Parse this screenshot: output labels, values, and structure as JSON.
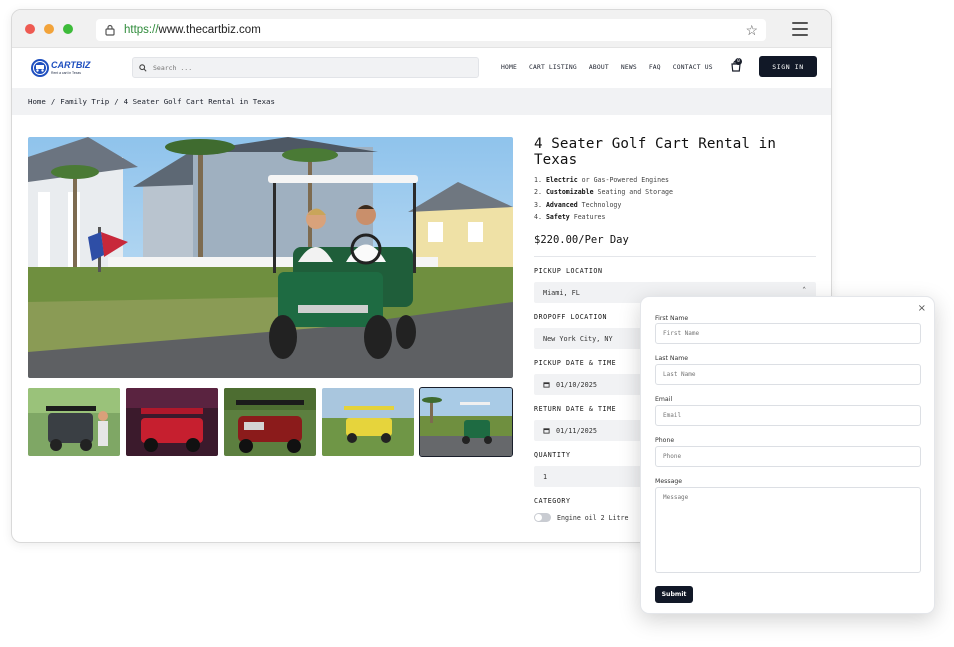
{
  "browser": {
    "url_scheme": "https://",
    "url_host": "www.thecartbiz.com"
  },
  "logo": {
    "name": "CARTBIZ",
    "tagline": "Rent a cart in Texas"
  },
  "search": {
    "placeholder": "Search ..."
  },
  "nav": {
    "items": [
      "HOME",
      "CART LISTING",
      "ABOUT",
      "NEWS",
      "FAQ",
      "CONTACT US"
    ],
    "cart_count": "0",
    "signin_label": "SIGN IN"
  },
  "breadcrumb": [
    "Home",
    "Family Trip",
    "4 Seater Golf Cart Rental in Texas"
  ],
  "product": {
    "title": "4 Seater Golf Cart Rental in Texas",
    "features": [
      {
        "num": "1.",
        "bold": "Electric",
        "rest": " or Gas-Powered Engines"
      },
      {
        "num": "2.",
        "bold": "Customizable",
        "rest": " Seating and Storage"
      },
      {
        "num": "3.",
        "bold": "Advanced",
        "rest": " Technology"
      },
      {
        "num": "4.",
        "bold": "Safety",
        "rest": " Features"
      }
    ],
    "price": "$220.00/Per Day"
  },
  "booking": {
    "pickup_label": "PICKUP LOCATION",
    "pickup_value": "Miami, FL",
    "dropoff_label": "DROPOFF LOCATION",
    "dropoff_value": "New York City, NY",
    "pickup_date_label": "PICKUP DATE & TIME",
    "pickup_date_value": "01/10/2025",
    "return_date_label": "RETURN DATE & TIME",
    "return_date_value": "01/11/2025",
    "quantity_label": "QUANTITY",
    "quantity_value": "1",
    "category_label": "CATEGORY",
    "category_option": "Engine oil 2 Litre"
  },
  "modal": {
    "close": "×",
    "first_name_label": "First Name",
    "first_name_placeholder": "First Name",
    "last_name_label": "Last Name",
    "last_name_placeholder": "Last Name",
    "email_label": "Email",
    "email_placeholder": "Email",
    "phone_label": "Phone",
    "phone_placeholder": "Phone",
    "message_label": "Message",
    "message_placeholder": "Message",
    "submit_label": "Submit"
  },
  "colors": {
    "primary_dark": "#111827",
    "accent_blue": "#1f4fbf",
    "field_bg": "#f1f2f4"
  }
}
